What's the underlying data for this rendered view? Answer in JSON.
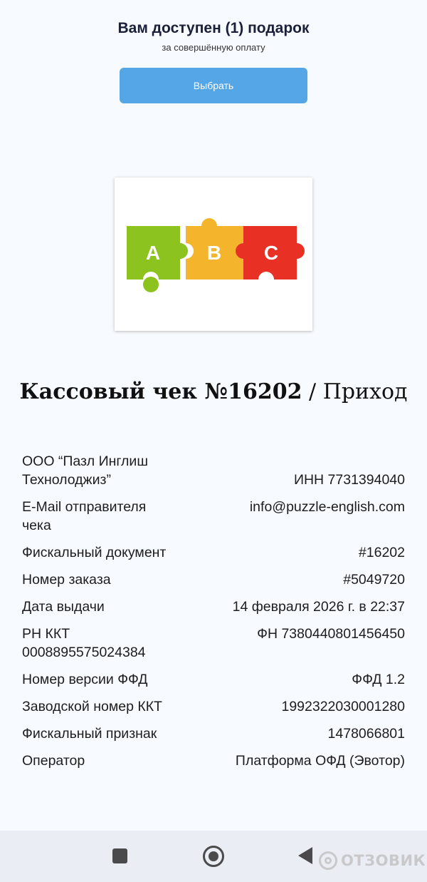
{
  "gift": {
    "title": "Вам доступен (1) подарок",
    "subtitle": "за совершённую оплату",
    "button_label": "Выбрать"
  },
  "logo": {
    "letters": [
      "A",
      "B",
      "C"
    ],
    "colors": [
      "#8cc31f",
      "#f4b42c",
      "#e83025"
    ]
  },
  "receipt": {
    "title_main": "Кассовый чек №16202",
    "title_separator": " / ",
    "title_type": "Приход",
    "rows": [
      {
        "label": "ООО “Пазл Инглиш Технолоджиз”",
        "value": "ИНН 7731394040"
      },
      {
        "label": "E-Mail отправителя чека",
        "value": "info@puzzle-english.com"
      },
      {
        "label": "Фискальный документ",
        "value": "#16202"
      },
      {
        "label": "Номер заказа",
        "value": "#5049720"
      },
      {
        "label": "Дата выдачи",
        "value": "14 февраля 2026 г. в 22:37"
      },
      {
        "label": "РН ККТ 0008895575024384",
        "value": "ФН 7380440801456450"
      },
      {
        "label": "Номер версии ФФД",
        "value": "ФФД 1.2"
      },
      {
        "label": "Заводской номер ККТ",
        "value": "1992322030001280"
      },
      {
        "label": "Фискальный признак",
        "value": "1478066801"
      },
      {
        "label": "Оператор",
        "value": "Платформа ОФД (Эвотор)"
      }
    ]
  },
  "navbar": {
    "icons": [
      "recents-square-icon",
      "home-circle-icon",
      "back-triangle-icon"
    ]
  },
  "watermark": {
    "text": "ОТЗОВИК"
  },
  "colors": {
    "accent_button": "#55a6e6",
    "background": "#f7fafe",
    "navbar": "#ebedf5"
  }
}
